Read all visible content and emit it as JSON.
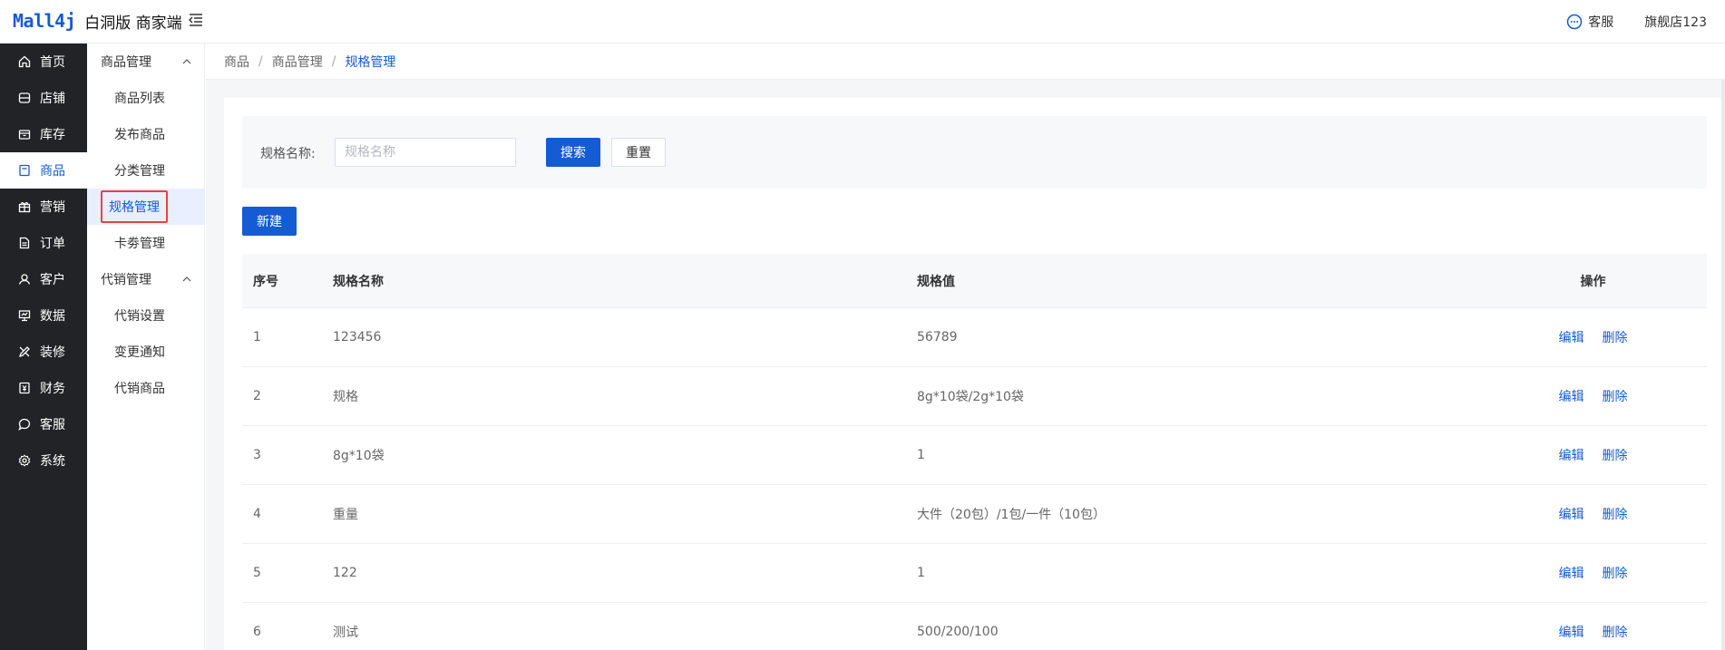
{
  "header": {
    "logo_mark": "Mall4j",
    "logo_text": "白洞版 商家端",
    "service_label": "客服",
    "shop_name": "旗舰店123"
  },
  "primary_nav": [
    {
      "label": "首页",
      "icon": "home-icon"
    },
    {
      "label": "店铺",
      "icon": "store-icon"
    },
    {
      "label": "库存",
      "icon": "inventory-icon"
    },
    {
      "label": "商品",
      "icon": "goods-icon",
      "active": true
    },
    {
      "label": "营销",
      "icon": "gift-icon"
    },
    {
      "label": "订单",
      "icon": "order-icon"
    },
    {
      "label": "客户",
      "icon": "customer-icon"
    },
    {
      "label": "数据",
      "icon": "data-icon"
    },
    {
      "label": "装修",
      "icon": "decorate-icon"
    },
    {
      "label": "财务",
      "icon": "finance-icon"
    },
    {
      "label": "客服",
      "icon": "chat-icon"
    },
    {
      "label": "系统",
      "icon": "settings-icon"
    }
  ],
  "secondary_nav": {
    "group1": {
      "title": "商品管理",
      "items": [
        "商品列表",
        "发布商品",
        "分类管理",
        "规格管理",
        "卡劵管理"
      ]
    },
    "group2": {
      "title": "代销管理",
      "items": [
        "代销设置",
        "变更通知",
        "代销商品"
      ]
    }
  },
  "breadcrumb": [
    "商品",
    "商品管理",
    "规格管理"
  ],
  "search": {
    "label": "规格名称:",
    "placeholder": "规格名称",
    "value": "",
    "search_btn": "搜索",
    "reset_btn": "重置"
  },
  "new_btn": "新建",
  "table": {
    "headers": [
      "序号",
      "规格名称",
      "规格值",
      "操作"
    ],
    "rows": [
      {
        "no": "1",
        "name": "123456",
        "value": "56789"
      },
      {
        "no": "2",
        "name": "规格",
        "value": "8g*10袋/2g*10袋"
      },
      {
        "no": "3",
        "name": "8g*10袋",
        "value": "1"
      },
      {
        "no": "4",
        "name": "重量",
        "value": "大件（20包）/1包/一件（10包）"
      },
      {
        "no": "5",
        "name": "122",
        "value": "1"
      },
      {
        "no": "6",
        "name": "测试",
        "value": "500/200/100"
      }
    ],
    "edit_label": "编辑",
    "delete_label": "删除"
  },
  "colors": {
    "accent": "#155bd4",
    "sidebar_bg": "#222326",
    "highlight_border": "#e9423d"
  }
}
